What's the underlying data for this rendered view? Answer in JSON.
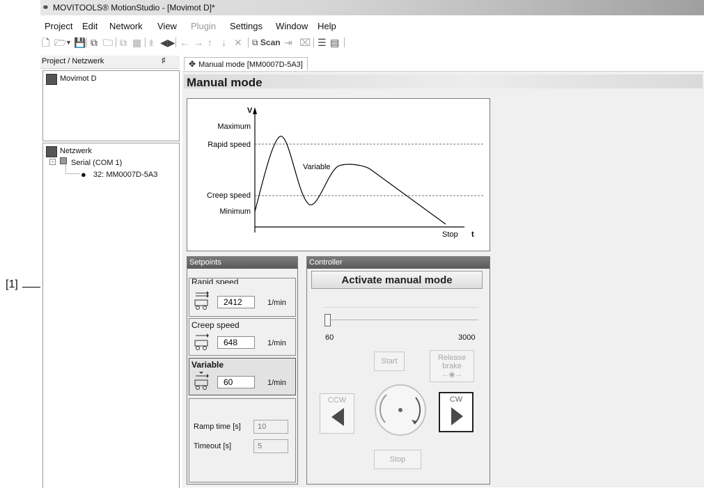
{
  "callout": {
    "label": "[1]"
  },
  "app": {
    "title": "MOVITOOLS® MotionStudio - [Movimot D]*"
  },
  "menu": {
    "items": [
      {
        "label": "Project",
        "disabled": false
      },
      {
        "label": "Edit",
        "disabled": false
      },
      {
        "label": "Network",
        "disabled": false
      },
      {
        "label": "View",
        "disabled": false
      },
      {
        "label": "Plugin",
        "disabled": true
      },
      {
        "label": "Settings",
        "disabled": false
      },
      {
        "label": "Window",
        "disabled": false
      },
      {
        "label": "Help",
        "disabled": false
      }
    ]
  },
  "toolbar": {
    "scan_label": "Scan",
    "icons": [
      "new-file-icon",
      "open-folder-icon",
      "save-icon",
      "copy-icon",
      "folder-icon",
      "copy-disabled-icon",
      "paste-disabled-icon",
      "connect-icon",
      "arrow-left-icon",
      "arrow-right-icon",
      "arrow-up-icon",
      "arrow-down-icon",
      "delete-icon",
      "scan-icon",
      "goto-end-icon",
      "close-box-icon",
      "list-icon",
      "export-icon"
    ]
  },
  "left_pane": {
    "header": "Project / Netzwerk",
    "pin_icon": "pin-icon",
    "project_item": "Movimot D",
    "network_root": "Netzwerk",
    "serial_node": "Serial (COM 1)",
    "device_node": "32: MM0007D-5A3"
  },
  "tab": {
    "label": "Manual mode [MM0007D-5A3]",
    "icon": "move-icon"
  },
  "page": {
    "title": "Manual mode"
  },
  "chart": {
    "v_label": "V",
    "t_label": "t",
    "maximum_label": "Maximum",
    "rapid_label": "Rapid speed",
    "creep_label": "Creep speed",
    "minimum_label": "Minimum",
    "variable_label": "Variable",
    "stop_label": "Stop"
  },
  "setpoints": {
    "header": "Setpoints",
    "rapid": {
      "title": "Rapid speed",
      "value": "2412",
      "unit": "1/min"
    },
    "creep": {
      "title": "Creep speed",
      "value": "648",
      "unit": "1/min"
    },
    "variable": {
      "title": "Variable",
      "value": "60",
      "unit": "1/min"
    },
    "ramp_label": "Ramp time [s]",
    "ramp_value": "10",
    "timeout_label": "Timeout [s]",
    "timeout_value": "5"
  },
  "controller": {
    "header": "Controller",
    "activate_label": "Activate manual mode",
    "slider_min": "60",
    "slider_max": "3000",
    "slider_value_fraction": 0,
    "start_label": "Start",
    "release_label_1": "Release",
    "release_label_2": "brake",
    "ccw_label": "CCW",
    "cw_label": "CW",
    "stop_label": "Stop"
  }
}
